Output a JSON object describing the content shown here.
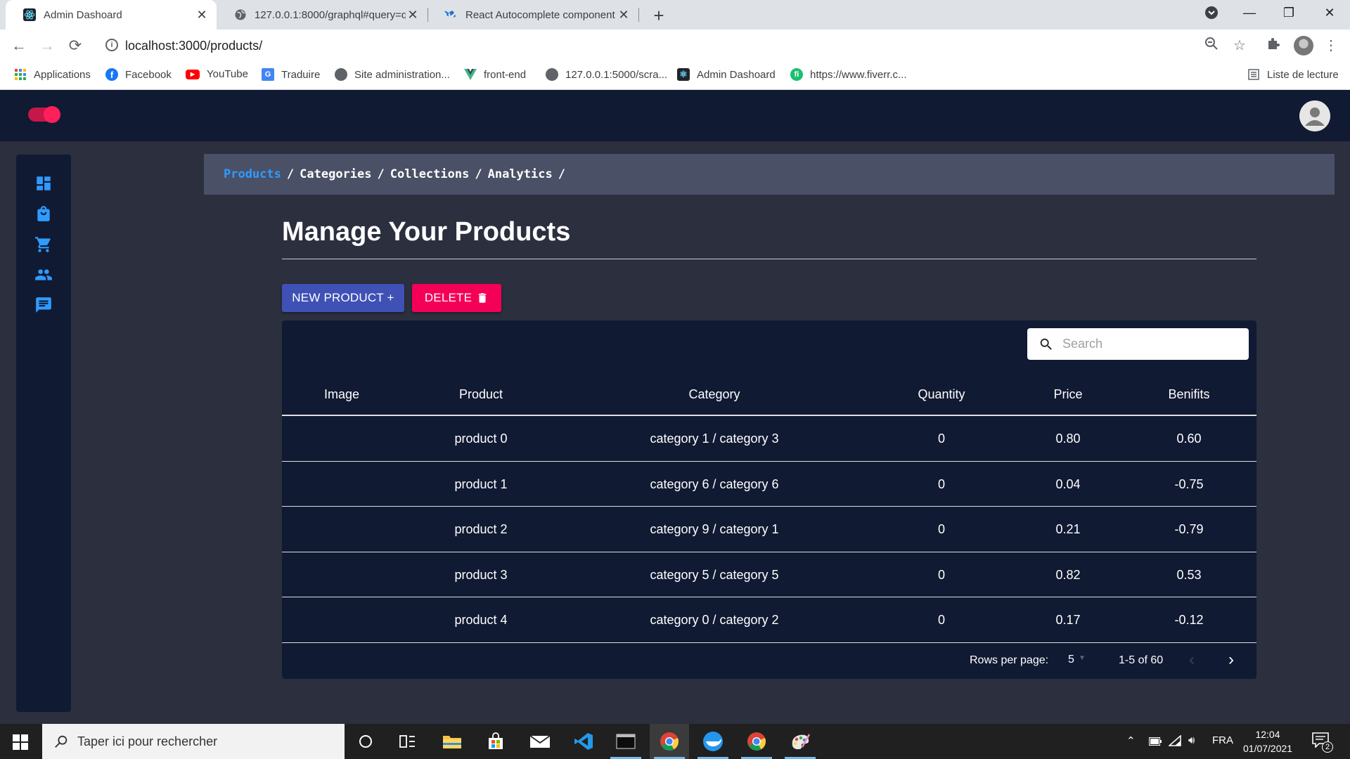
{
  "browser": {
    "tabs": [
      {
        "title": "Admin Dashoard",
        "icon": "react-atom-icon",
        "active": true
      },
      {
        "title": "127.0.0.1:8000/graphql#query=q",
        "icon": "globe-icon",
        "active": false
      },
      {
        "title": "React Autocomplete component",
        "icon": "mui-icon",
        "active": false
      }
    ],
    "url": "localhost:3000/products/",
    "bookmarks": [
      {
        "label": "Applications",
        "icon": "apps-grid-icon"
      },
      {
        "label": "Facebook",
        "icon": "facebook-icon"
      },
      {
        "label": "YouTube",
        "icon": "youtube-icon"
      },
      {
        "label": "Traduire",
        "icon": "translate-icon"
      },
      {
        "label": "Site administration...",
        "icon": "globe-icon"
      },
      {
        "label": "front-end",
        "icon": "vue-icon"
      },
      {
        "label": "127.0.0.1:5000/scra...",
        "icon": "globe-icon"
      },
      {
        "label": "Admin Dashoard",
        "icon": "react-atom-icon"
      },
      {
        "label": "https://www.fiverr.c...",
        "icon": "fiverr-icon"
      }
    ],
    "reading_list": "Liste de lecture"
  },
  "header": {
    "toggle_on": true,
    "accent_color": "#ff1f5a",
    "background_color": "#111a33"
  },
  "sidenav": {
    "items": [
      {
        "name": "dashboard-icon"
      },
      {
        "name": "shopping-bag-icon"
      },
      {
        "name": "cart-icon"
      },
      {
        "name": "people-icon"
      },
      {
        "name": "chat-icon"
      }
    ]
  },
  "breadcrumb": {
    "items": [
      "Products",
      "Categories",
      "Collections",
      "Analytics"
    ],
    "separator": "/",
    "active_color": "#2f9bff"
  },
  "main": {
    "title": "Manage Your Products",
    "new_button": "NEW PRODUCT +",
    "delete_button": "DELETE",
    "search_placeholder": "Search",
    "columns": [
      "Image",
      "Product",
      "Category",
      "Quantity",
      "Price",
      "Benifits"
    ],
    "rows": [
      {
        "image": "",
        "product": "product 0",
        "category": "category 1 / category 3",
        "quantity": "0",
        "price": "0.80",
        "benefits": "0.60"
      },
      {
        "image": "",
        "product": "product 1",
        "category": "category 6 / category 6",
        "quantity": "0",
        "price": "0.04",
        "benefits": "-0.75"
      },
      {
        "image": "",
        "product": "product 2",
        "category": "category 9 / category 1",
        "quantity": "0",
        "price": "0.21",
        "benefits": "-0.79"
      },
      {
        "image": "",
        "product": "product 3",
        "category": "category 5 / category 5",
        "quantity": "0",
        "price": "0.82",
        "benefits": "0.53"
      },
      {
        "image": "",
        "product": "product 4",
        "category": "category 0 / category 2",
        "quantity": "0",
        "price": "0.17",
        "benefits": "-0.12"
      }
    ],
    "pagination": {
      "rows_per_page_label": "Rows per page:",
      "rows_per_page": "5",
      "range": "1-5 of 60"
    }
  },
  "taskbar": {
    "search_placeholder": "Taper ici pour rechercher",
    "language": "FRA",
    "time": "12:04",
    "date": "01/07/2021",
    "notification_count": "2"
  }
}
